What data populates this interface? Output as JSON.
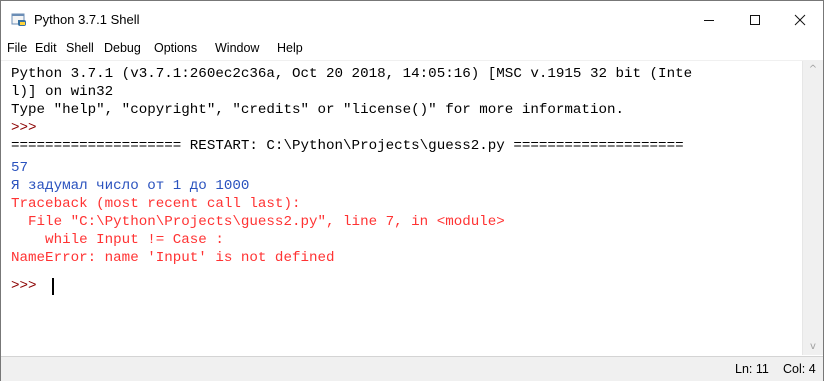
{
  "window": {
    "title": "Python 3.7.1 Shell",
    "icon": "python-idle-icon",
    "controls": {
      "minimize": "—",
      "maximize": "☐",
      "close": "✕"
    }
  },
  "menubar": {
    "items": [
      "File",
      "Edit",
      "Shell",
      "Debug",
      "Options",
      "Window",
      "Help"
    ]
  },
  "shell": {
    "lines": [
      {
        "text": "Python 3.7.1 (v3.7.1:260ec2c36a, Oct 20 2018, 14:05:16) [MSC v.1915 32 bit (Inte",
        "style": "std"
      },
      {
        "text": "l)] on win32",
        "style": "std"
      },
      {
        "text": "Type \"help\", \"copyright\", \"credits\" or \"license()\" for more information.",
        "style": "std"
      },
      {
        "text": ">>> ",
        "style": "prompt"
      },
      {
        "text": "==================== RESTART: C:\\Python\\Projects\\guess2.py ====================",
        "style": "std"
      },
      {
        "text": "57",
        "style": "out"
      },
      {
        "text": "Я задумал число от 1 до 1000",
        "style": "out"
      },
      {
        "text": "Traceback (most recent call last):",
        "style": "err"
      },
      {
        "text": "  File \"C:\\Python\\Projects\\guess2.py\", line 7, in <module>",
        "style": "err"
      },
      {
        "text": "    while Input != Case :",
        "style": "err"
      },
      {
        "text": "NameError: name 'Input' is not defined",
        "style": "err"
      },
      {
        "text": ">>> ",
        "style": "prompt"
      }
    ]
  },
  "scrollbar": {
    "up_arrow": "^",
    "down_arrow": "v"
  },
  "statusbar": {
    "line": "Ln: 11",
    "col": "Col: 4"
  }
}
